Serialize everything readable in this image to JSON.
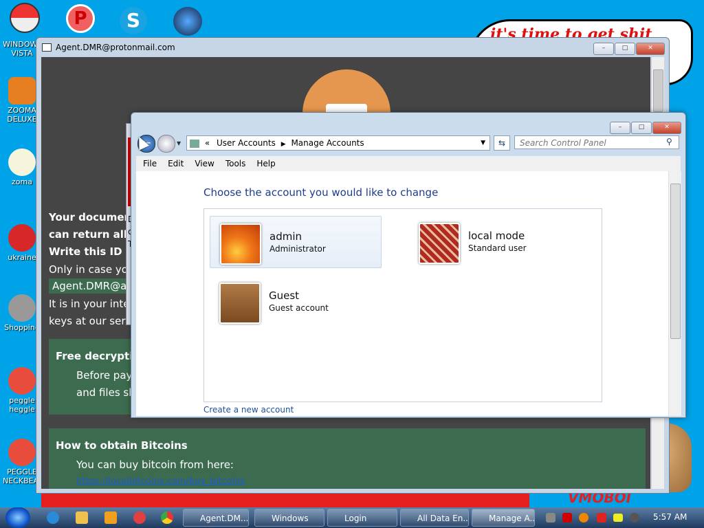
{
  "desktop": {
    "icons": [
      {
        "label": "WINDOWS VISTA",
        "color": "#c0392b"
      },
      {
        "label": "ZOOMA DELUXE",
        "color": "#e67e22"
      },
      {
        "label": "zoma",
        "color": "#ffffff"
      },
      {
        "label": "ukraine",
        "color": "#d62828"
      },
      {
        "label": "Shopping",
        "color": "#888888"
      },
      {
        "label": "peggle heggle",
        "color": "#e74c3c"
      },
      {
        "label": "PEGGLE NECKBEARD",
        "color": "#e74c3c"
      }
    ],
    "top_icons": [
      "pokeball-icon",
      "peggle-icon",
      "skype-icon",
      "planet-icon"
    ],
    "banner_text": "it's time to get shit",
    "mascot_text": "VMOBOI"
  },
  "ransom_window": {
    "title": "Agent.DMR@protonmail.com",
    "lines": [
      "Your documen",
      "can return all",
      "Write this ID i",
      "Only in case you",
      "Agent.DMR@ac",
      "It is in your inter",
      "keys at our serv"
    ],
    "free_decryption": {
      "heading": "Free decryptio",
      "line1": "Before payin",
      "line2": "and files sho"
    },
    "bitcoins": {
      "heading": "How to obtain Bitcoins",
      "line1": "You can buy bitcoin from here:",
      "link": "https://localbitcoins.com/buy_bitcoins"
    },
    "behind_dialog_chars": [
      "D",
      "o",
      "T"
    ]
  },
  "control_panel": {
    "breadcrumb_sep": "«",
    "breadcrumb": [
      "User Accounts",
      "Manage Accounts"
    ],
    "search_placeholder": "Search Control Panel",
    "menu": [
      "File",
      "Edit",
      "View",
      "Tools",
      "Help"
    ],
    "heading": "Choose the account you would like to change",
    "accounts": [
      {
        "name": "admin",
        "type": "Administrator",
        "color": "#f07818"
      },
      {
        "name": "local mode",
        "type": "Standard user",
        "color": "#b02828"
      },
      {
        "name": "Guest",
        "type": "Guest account",
        "color": "#8a5a2e"
      }
    ],
    "create_link": "Create a new account"
  },
  "taskbar": {
    "tasks": [
      "Agent.DM...",
      "Windows",
      "Login",
      "All Data En...",
      "Manage A..."
    ],
    "time": "5:57 AM"
  }
}
